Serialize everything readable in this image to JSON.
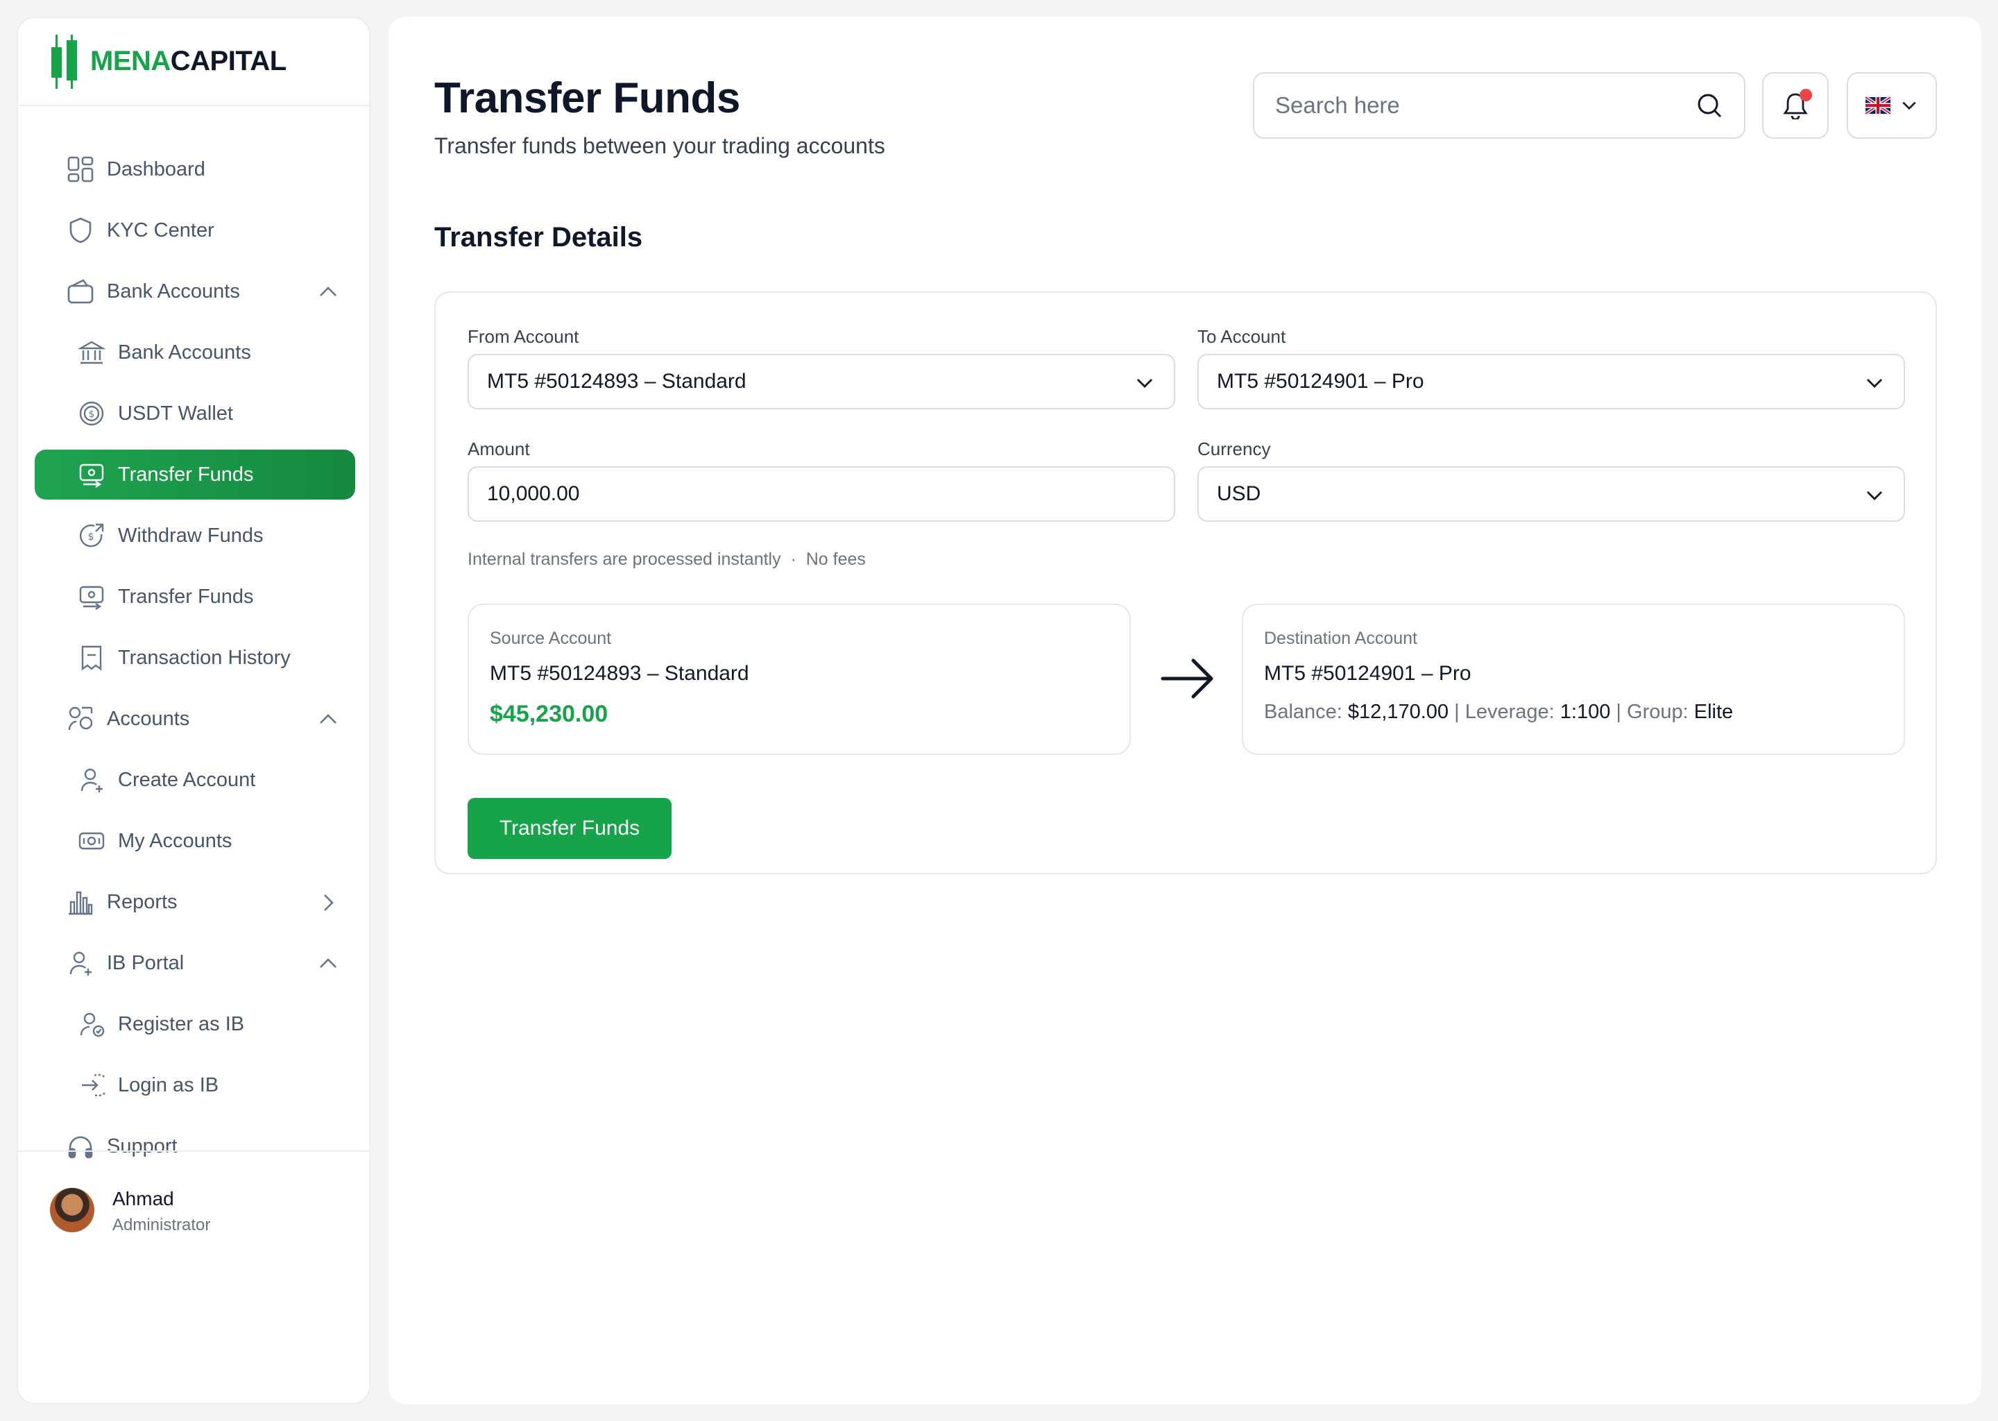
{
  "brand": {
    "name_green": "MENA",
    "name_dark": "CAPITAL"
  },
  "sidebar": {
    "items": [
      {
        "label": "Dashboard",
        "icon": "dashboard-icon"
      },
      {
        "label": "KYC Center",
        "icon": "shield-icon"
      },
      {
        "label": "Bank Accounts",
        "icon": "wallet-icon",
        "expanded": true
      },
      {
        "label": "Bank Accounts",
        "icon": "bank-icon"
      },
      {
        "label": "USDT Wallet",
        "icon": "coin-icon"
      },
      {
        "label": "Transfer Funds",
        "icon": "transfer-icon",
        "active": true
      },
      {
        "label": "Withdraw Funds",
        "icon": "withdraw-icon"
      },
      {
        "label": "Transfer Funds",
        "icon": "transfer-icon"
      },
      {
        "label": "Transaction History",
        "icon": "receipt-icon"
      },
      {
        "label": "Accounts",
        "icon": "accounts-icon",
        "expanded": true
      },
      {
        "label": "Create Account",
        "icon": "user-add-icon"
      },
      {
        "label": "My Accounts",
        "icon": "cash-icon"
      },
      {
        "label": "Reports",
        "icon": "chart-icon",
        "expanded": false
      },
      {
        "label": "IB Portal",
        "icon": "user-plus-icon",
        "expanded": true
      },
      {
        "label": "Register as IB",
        "icon": "user-register-icon"
      },
      {
        "label": "Login as IB",
        "icon": "login-icon"
      },
      {
        "label": "Support",
        "icon": "headset-icon"
      }
    ]
  },
  "user": {
    "name": "Ahmad",
    "role": "Administrator"
  },
  "header": {
    "title": "Transfer Funds",
    "subtitle": "Transfer funds between your trading accounts",
    "search_placeholder": "Search here",
    "language_flag": "uk-flag-icon"
  },
  "transfer": {
    "section_title": "Transfer Details",
    "from_label": "From Account",
    "from_value": "MT5 #50124893 – Standard",
    "to_label": "To Account",
    "to_value": "MT5 #50124901 – Pro",
    "amount_label": "Amount",
    "amount_value": "10,000.00",
    "currency_label": "Currency",
    "currency_value": "USD",
    "note": "Internal transfers are processed instantly  ·  No fees",
    "source": {
      "label": "Source Account",
      "account": "MT5 #50124893 – Standard",
      "balance": "$45,230.00"
    },
    "destination": {
      "label": "Destination Account",
      "account": "MT5 #50124901 – Pro",
      "balance_label": "Balance:",
      "balance": "$12,170.00",
      "leverage_label": "Leverage:",
      "leverage": "1:100",
      "group_label": "Group:",
      "group": "Elite"
    },
    "submit_label": "Transfer Funds"
  },
  "colors": {
    "accent": "#16a34a",
    "notification": "#ef4444"
  }
}
